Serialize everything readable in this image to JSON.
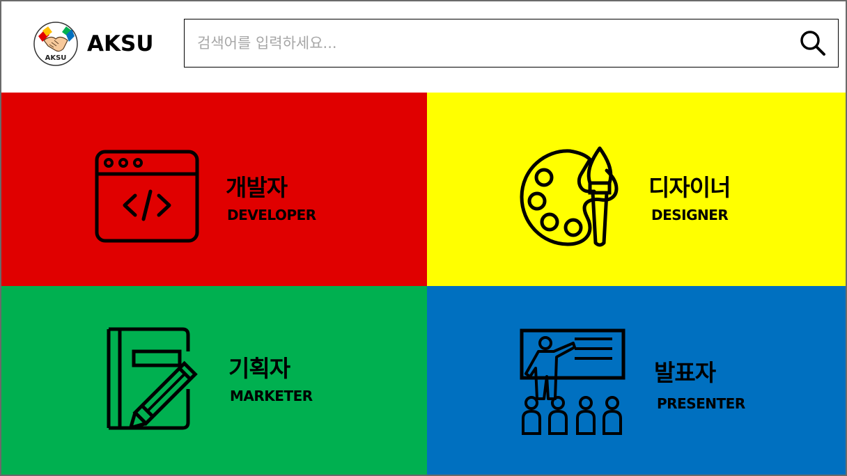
{
  "brand": {
    "name": "AKSU",
    "badge_text": "AKSU",
    "logo_icon": "handshake-icon"
  },
  "search": {
    "placeholder": "검색어를 입력하세요...",
    "value": "",
    "icon": "search-icon"
  },
  "roles": [
    {
      "title": "개발자",
      "subtitle": "DEVELOPER",
      "icon": "code-window-icon",
      "color": "#E00000"
    },
    {
      "title": "디자이너",
      "subtitle": "DESIGNER",
      "icon": "palette-brush-icon",
      "color": "#FFFF00"
    },
    {
      "title": "기획자",
      "subtitle": "MARKETER",
      "icon": "notebook-pencil-icon",
      "color": "#00B050"
    },
    {
      "title": "발표자",
      "subtitle": "PRESENTER",
      "icon": "presentation-audience-icon",
      "color": "#0070C0"
    }
  ]
}
